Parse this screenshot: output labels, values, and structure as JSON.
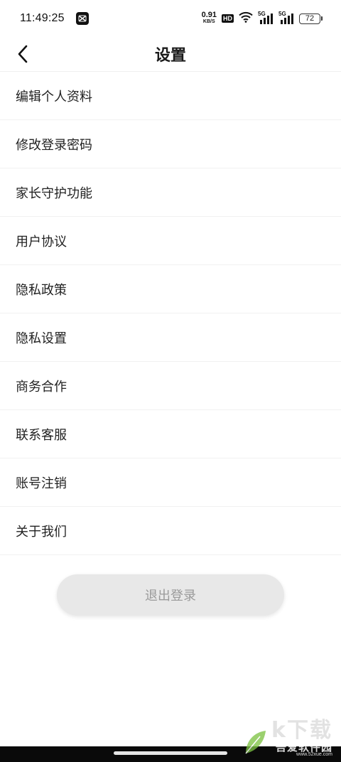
{
  "status_bar": {
    "time": "11:49:25",
    "net_speed_value": "0.91",
    "net_speed_unit": "KB/S",
    "hd_label": "HD",
    "signal_labels": [
      "5G",
      "5G"
    ],
    "battery": "72"
  },
  "nav": {
    "title": "设置"
  },
  "menu": {
    "items": [
      {
        "label": "编辑个人资料"
      },
      {
        "label": "修改登录密码"
      },
      {
        "label": "家长守护功能"
      },
      {
        "label": "用户协议"
      },
      {
        "label": "隐私政策"
      },
      {
        "label": "隐私设置"
      },
      {
        "label": "商务合作"
      },
      {
        "label": "联系客服"
      },
      {
        "label": "账号注销"
      },
      {
        "label": "关于我们"
      }
    ]
  },
  "logout": {
    "label": "退出登录"
  },
  "watermark": {
    "glyphs": "k下载",
    "site_name": "吾爱软件园",
    "url": "www.52xue.com"
  },
  "colors": {
    "title_text": "#1a1a1a",
    "item_text": "#222222",
    "divider": "#f1f1f1",
    "logout_bg": "#e8e8e8",
    "logout_text": "#9a9a9a"
  }
}
